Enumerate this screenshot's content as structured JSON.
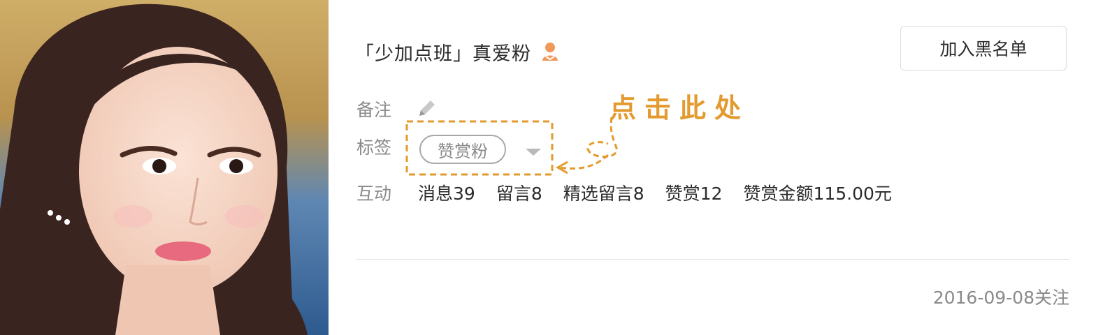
{
  "profile": {
    "nickname": "「少加点班」真爱粉",
    "fan_badge_icon": "fan-badge-icon"
  },
  "actions": {
    "blacklist_label": "加入黑名单"
  },
  "remark": {
    "label": "备注",
    "edit_icon": "pencil-icon"
  },
  "tags": {
    "label": "标签",
    "items": [
      "赞赏粉"
    ],
    "dropdown_icon": "caret-down-icon"
  },
  "interaction": {
    "label": "互动",
    "stats": [
      "消息39",
      "留言8",
      "精选留言8",
      "赞赏12",
      "赞赏金额115.00元"
    ]
  },
  "follow_date": "2016-09-08关注",
  "annotation": {
    "text": "点击此处",
    "color": "#e39a2f"
  },
  "colors": {
    "primary_text": "#2b2b2b",
    "secondary_text": "#8a8a8a",
    "annotation": "#e39a2f",
    "fan_badge": "#f0995a"
  }
}
